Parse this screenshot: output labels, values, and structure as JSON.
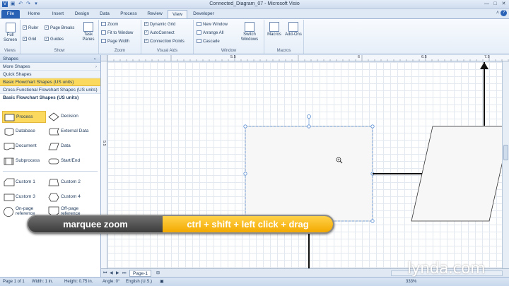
{
  "window": {
    "title": "Connected_Diagram_07 - Microsoft Visio",
    "controls": [
      "—",
      "□",
      "✕"
    ]
  },
  "tabs": [
    "File",
    "Home",
    "Insert",
    "Design",
    "Data",
    "Process",
    "Review",
    "View",
    "Developer"
  ],
  "active_tab": "View",
  "ribbon": {
    "views": {
      "label": "Views",
      "full_screen": "Full Screen"
    },
    "show": {
      "label": "Show",
      "ruler": "Ruler",
      "page_breaks": "Page Breaks",
      "grid": "Grid",
      "guides": "Guides",
      "task_panes": "Task Panes"
    },
    "zoom": {
      "label": "Zoom",
      "zoom": "Zoom",
      "fit_to_window": "Fit to Window",
      "page_width": "Page Width"
    },
    "visual_aids": {
      "label": "Visual Aids",
      "dynamic_grid": "Dynamic Grid",
      "autoconnect": "AutoConnect",
      "connection_points": "Connection Points"
    },
    "window": {
      "label": "Window",
      "new_window": "New Window",
      "arrange_all": "Arrange All",
      "cascade": "Cascade",
      "switch_windows": "Switch Windows"
    },
    "macros": {
      "label": "Macros",
      "macros": "Macros",
      "add_ons": "Add-Ons"
    }
  },
  "shapes_pane": {
    "title": "Shapes",
    "more_shapes": "More Shapes",
    "quick_shapes": "Quick Shapes",
    "basic_flowchart": "Basic Flowchart Shapes (US units)",
    "cross_functional": "Cross-Functional Flowchart Shapes (US units)",
    "stencil_title": "Basic Flowchart Shapes (US units)",
    "masters": [
      "Process",
      "Decision",
      "Database",
      "External Data",
      "Document",
      "Data",
      "Subprocess",
      "Start/End",
      "Custom 1",
      "Custom 2",
      "Custom 3",
      "Custom 4",
      "On-page reference",
      "Off-page reference"
    ]
  },
  "ruler": {
    "marks": [
      "5.5",
      "6",
      "6.5",
      "7",
      "7.5"
    ],
    "left_mark": "5.5"
  },
  "page_tab": "Page-1",
  "status": {
    "page": "Page 1 of 1",
    "width": "Width: 1 in.",
    "height": "Height: 0.75 in.",
    "angle": "Angle: 0°",
    "language": "English (U.S.)",
    "zoom": "333%"
  },
  "caption": {
    "left": "marquee zoom",
    "right": "ctrl + shift + left click + drag"
  },
  "logo": "lynda.com",
  "colors": {
    "accent": "#2a62b6",
    "caption_yellow": "#f7b500",
    "selection": "#5b8fd3"
  }
}
